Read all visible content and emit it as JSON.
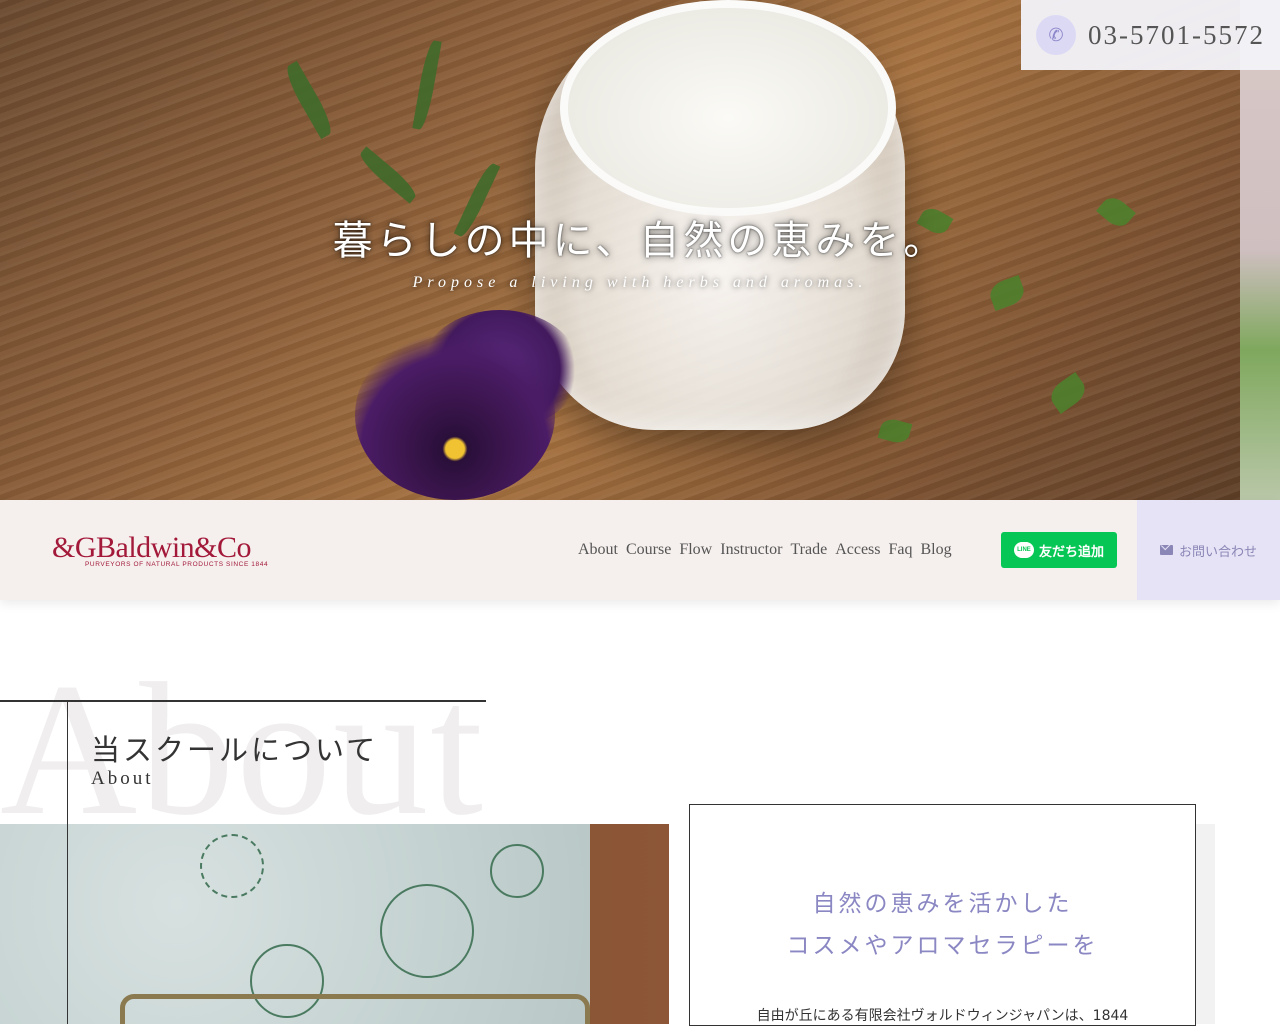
{
  "header": {
    "phone": "03-5701-5572",
    "hero_headline": "暮らしの中に、自然の恵みを。",
    "hero_subline": "Propose a living with herbs and aromas."
  },
  "logo": {
    "main": "&GBaldwin&Co",
    "sub": "PURVEYORS OF NATURAL PRODUCTS SINCE 1844"
  },
  "nav": {
    "items": [
      {
        "label": "About"
      },
      {
        "label": "Course"
      },
      {
        "label": "Flow"
      },
      {
        "label": "Instructor"
      },
      {
        "label": "Trade"
      },
      {
        "label": "Access"
      },
      {
        "label": "Faq"
      },
      {
        "label": "Blog"
      }
    ],
    "line_button": "友だち追加",
    "line_icon_text": "LINE",
    "contact_button": "お問い合わせ"
  },
  "about": {
    "bg_word": "About",
    "title": "当スクールについて",
    "subtitle": "About",
    "card_heading_line1": "自然の恵みを活かした",
    "card_heading_line2": "コスメやアロマセラピーを",
    "card_text": "自由が丘にある有限会社ヴォルドウィンジャパンは、1844"
  },
  "colors": {
    "brand": "#a3193a",
    "accent_lavender": "#8a87c3",
    "line_green": "#06c755"
  }
}
